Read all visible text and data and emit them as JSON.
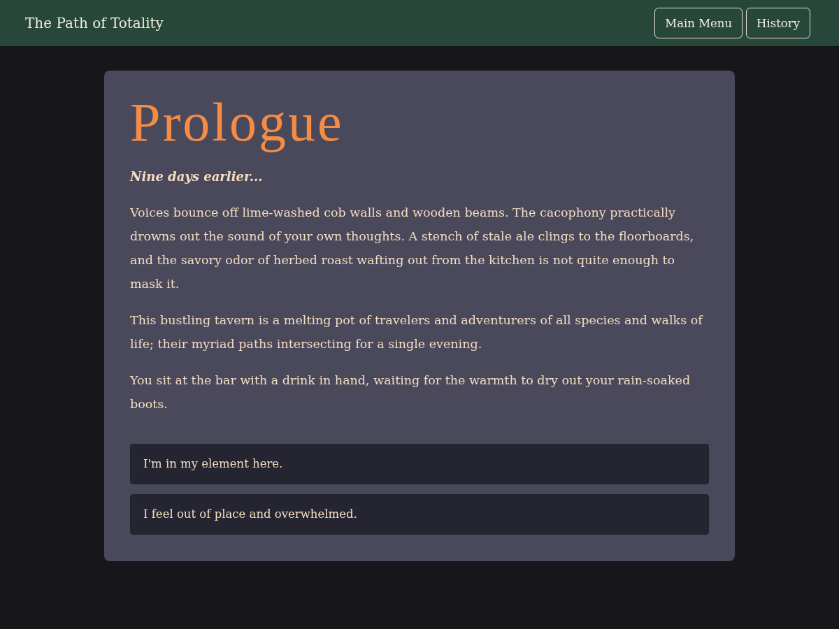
{
  "header": {
    "title": "The Path of Totality",
    "buttons": [
      {
        "label": "Main Menu"
      },
      {
        "label": "History"
      }
    ]
  },
  "story": {
    "title": "Prologue",
    "subtitle": "Nine days earlier...",
    "paragraphs": [
      "Voices bounce off lime-washed cob walls and wooden beams. The cacophony practically drowns out the sound of your own thoughts. A stench of stale ale clings to the floorboards, and the savory odor of herbed roast wafting out from the kitchen is not quite enough to mask it.",
      "This bustling tavern is a melting pot of travelers and adventurers of all species and walks of life; their myriad paths intersecting for a single evening.",
      "You sit at the bar with a drink in hand, waiting for the warmth to dry out your rain-soaked boots."
    ]
  },
  "choices": [
    {
      "label": "I'm in my element here."
    },
    {
      "label": "I feel out of place and overwhelmed."
    }
  ]
}
